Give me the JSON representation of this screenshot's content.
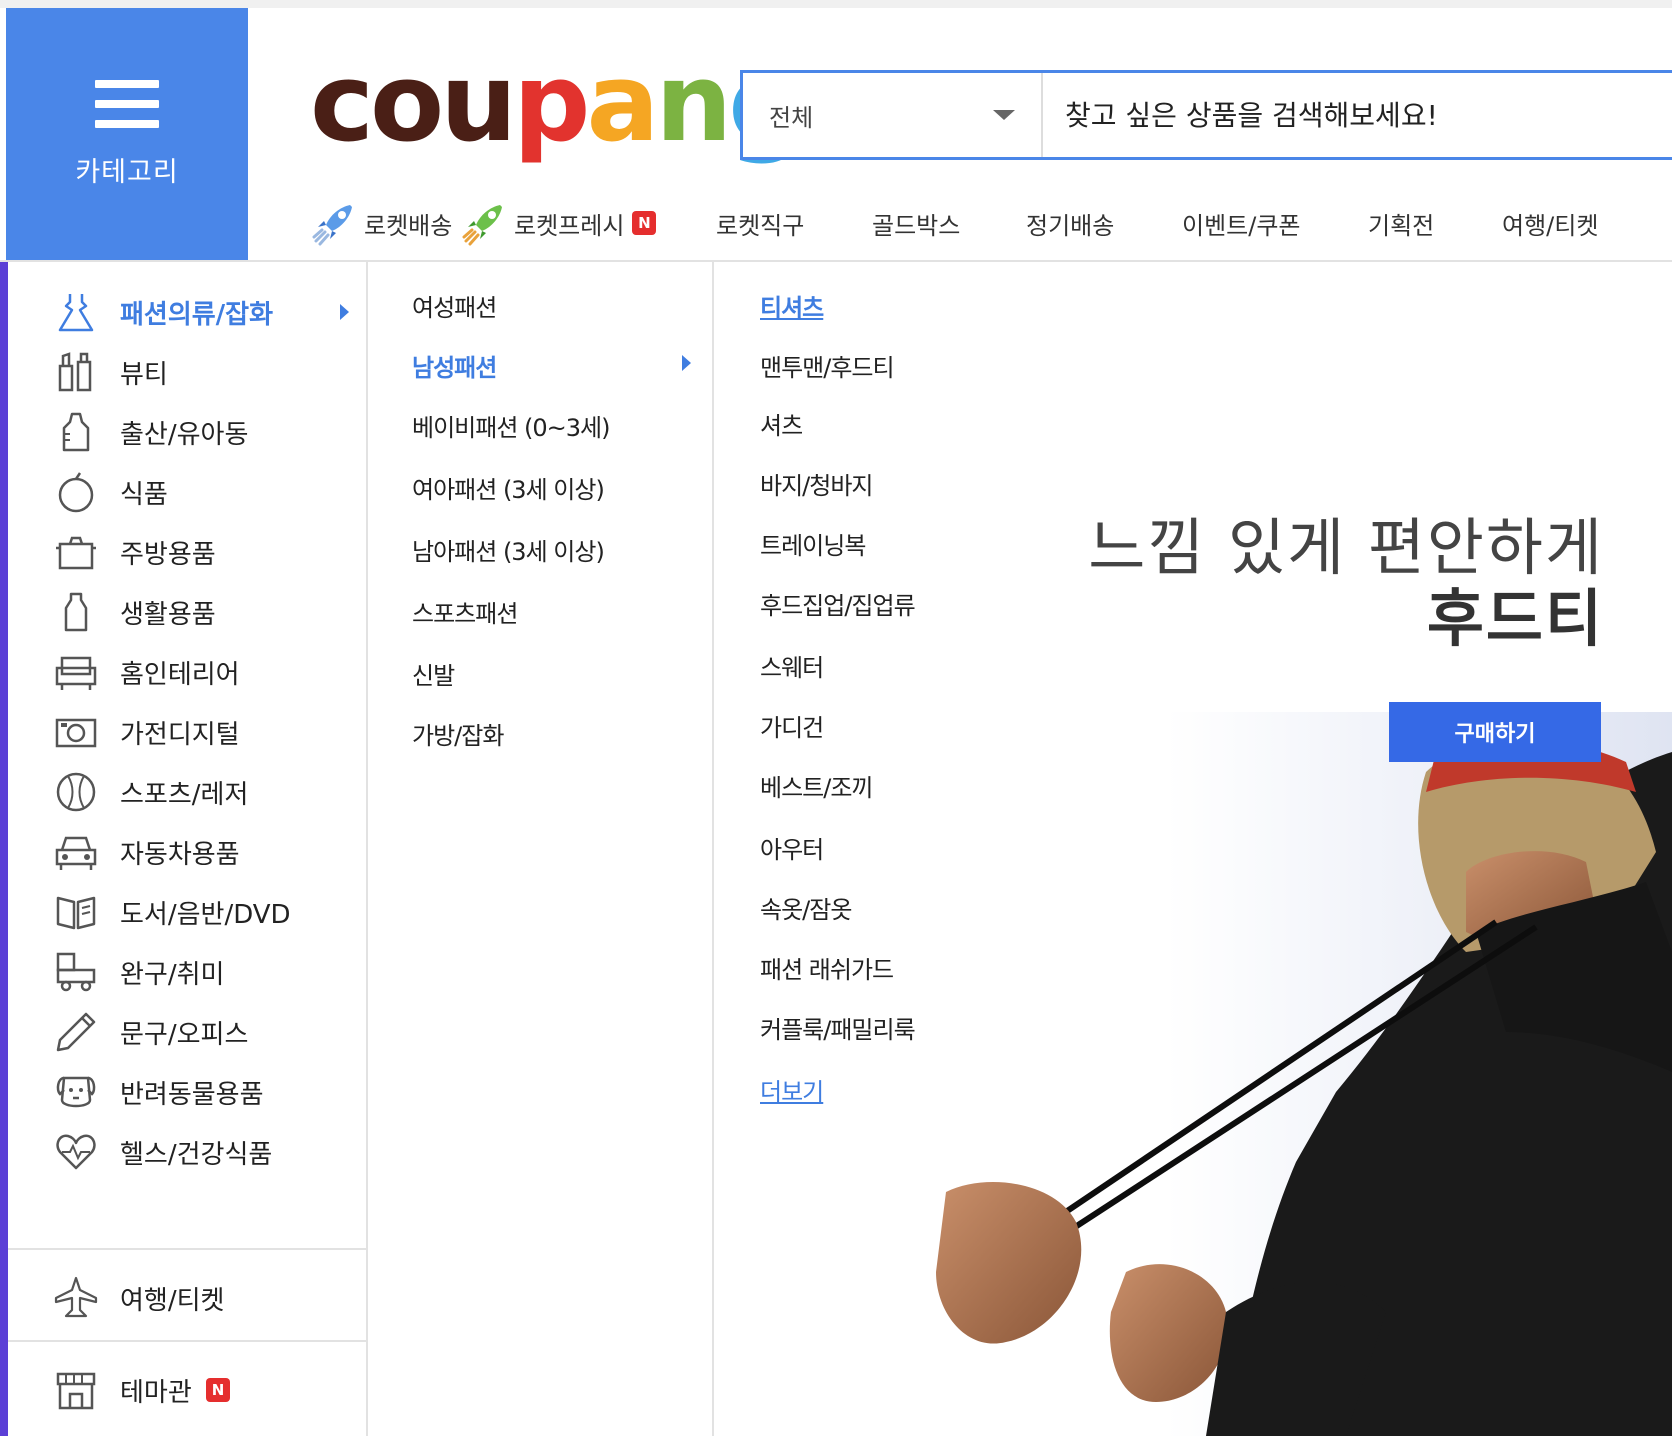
{
  "header": {
    "category_button_label": "카테고리",
    "logo": {
      "letters": [
        "c",
        "o",
        "u",
        "p",
        "a",
        "n",
        "g"
      ],
      "colors": [
        "#4a1f16",
        "#4a1f16",
        "#4a1f16",
        "#e2332e",
        "#f5a623",
        "#7cb342",
        "#3fa9e6"
      ]
    },
    "search": {
      "scope": "전체",
      "placeholder": "찾고 싶은 상품을 검색해보세요!"
    },
    "nav": [
      {
        "label": "로켓배송",
        "icon": "rocket-blue-icon"
      },
      {
        "label": "로켓프레시",
        "icon": "rocket-green-icon",
        "badge": "N"
      },
      {
        "label": "로켓직구"
      },
      {
        "label": "골드박스"
      },
      {
        "label": "정기배송"
      },
      {
        "label": "이벤트/쿠폰"
      },
      {
        "label": "기획전"
      },
      {
        "label": "여행/티켓"
      }
    ]
  },
  "categories": [
    {
      "label": "패션의류/잡화",
      "icon": "dress-icon",
      "active": true
    },
    {
      "label": "뷰티",
      "icon": "cosmetics-icon"
    },
    {
      "label": "출산/유아동",
      "icon": "baby-bottle-icon"
    },
    {
      "label": "식품",
      "icon": "apple-icon"
    },
    {
      "label": "주방용품",
      "icon": "pot-icon"
    },
    {
      "label": "생활용품",
      "icon": "bottle-icon"
    },
    {
      "label": "홈인테리어",
      "icon": "sofa-icon"
    },
    {
      "label": "가전디지털",
      "icon": "camera-icon"
    },
    {
      "label": "스포츠/레저",
      "icon": "ball-icon"
    },
    {
      "label": "자동차용품",
      "icon": "car-icon"
    },
    {
      "label": "도서/음반/DVD",
      "icon": "book-icon"
    },
    {
      "label": "완구/취미",
      "icon": "toy-icon"
    },
    {
      "label": "문구/오피스",
      "icon": "pencil-icon"
    },
    {
      "label": "반려동물용품",
      "icon": "dog-icon"
    },
    {
      "label": "헬스/건강식품",
      "icon": "heart-icon"
    }
  ],
  "extra_categories": [
    {
      "label": "여행/티켓",
      "icon": "airplane-icon"
    },
    {
      "label": "테마관",
      "icon": "store-icon",
      "badge": "N"
    }
  ],
  "subcategories": [
    {
      "label": "여성패션"
    },
    {
      "label": "남성패션",
      "active": true
    },
    {
      "label": "베이비패션 (0~3세)"
    },
    {
      "label": "여아패션 (3세 이상)"
    },
    {
      "label": "남아패션 (3세 이상)"
    },
    {
      "label": "스포츠패션"
    },
    {
      "label": "신발"
    },
    {
      "label": "가방/잡화"
    }
  ],
  "sub_subcategories": [
    {
      "label": "티셔츠",
      "active": true
    },
    {
      "label": "맨투맨/후드티"
    },
    {
      "label": "셔츠"
    },
    {
      "label": "바지/청바지"
    },
    {
      "label": "트레이닝복"
    },
    {
      "label": "후드집업/집업류"
    },
    {
      "label": "스웨터"
    },
    {
      "label": "가디건"
    },
    {
      "label": "베스트/조끼"
    },
    {
      "label": "아우터"
    },
    {
      "label": "속옷/잠옷"
    },
    {
      "label": "패션 래쉬가드"
    },
    {
      "label": "커플룩/패밀리룩"
    }
  ],
  "more_label": "더보기",
  "banner": {
    "line1": "느낌 있게 편안하게",
    "line2": "후드티",
    "button_label": "구매하기"
  }
}
